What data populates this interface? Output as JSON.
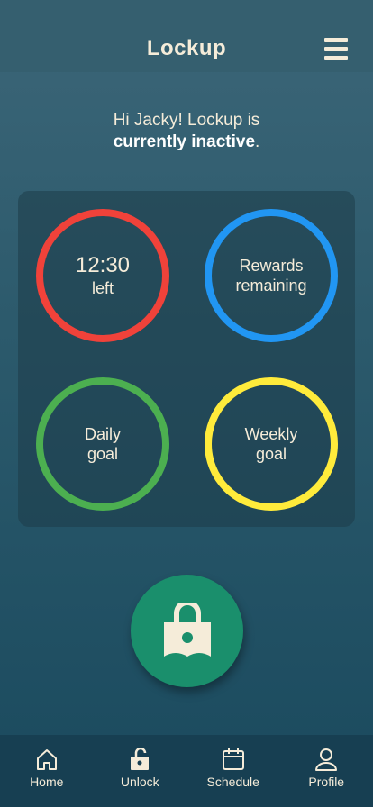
{
  "header": {
    "title": "Lockup",
    "menu_icon": "hamburger-menu-icon"
  },
  "greeting": {
    "line1": "Hi Jacky! Lockup is",
    "status": "currently inactive",
    "suffix": "."
  },
  "stats": [
    {
      "line1": "12:30",
      "line2": "left",
      "color": "#f0423a"
    },
    {
      "line1": "Rewards",
      "line2": "remaining",
      "color": "#2196f3"
    },
    {
      "line1": "Daily",
      "line2": "goal",
      "color": "#4caf50"
    },
    {
      "line1": "Weekly",
      "line2": "goal",
      "color": "#ffeb3b"
    }
  ],
  "lock_button": {
    "icon": "book-lock-icon",
    "color": "#1a8f6c"
  },
  "nav": {
    "items": [
      {
        "label": "Home",
        "icon": "home-icon"
      },
      {
        "label": "Unlock",
        "icon": "unlock-icon"
      },
      {
        "label": "Schedule",
        "icon": "calendar-icon"
      },
      {
        "label": "Profile",
        "icon": "user-icon"
      }
    ]
  },
  "colors": {
    "accent": "#1a8f6c",
    "text": "#f5ecd9",
    "nav_bg": "#173f52"
  }
}
